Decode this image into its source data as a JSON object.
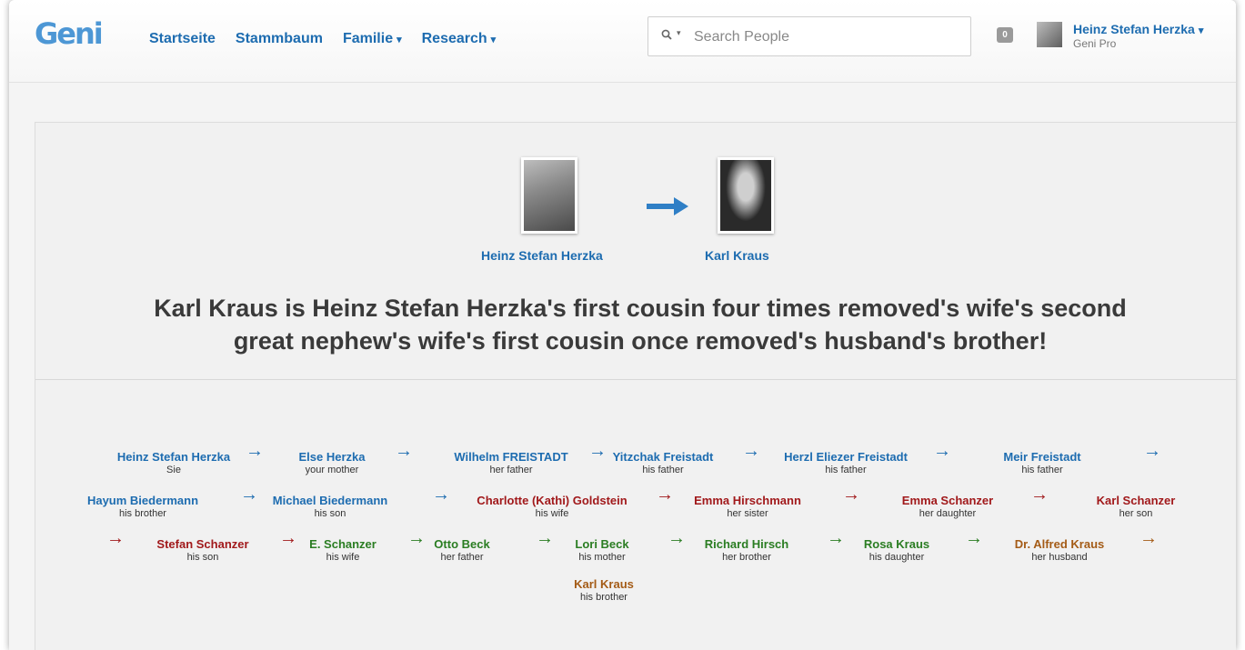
{
  "header": {
    "logo": "Geni",
    "nav": [
      {
        "label": "Startseite",
        "dropdown": false
      },
      {
        "label": "Stammbaum",
        "dropdown": false
      },
      {
        "label": "Familie",
        "dropdown": true
      },
      {
        "label": "Research",
        "dropdown": true
      }
    ],
    "search_placeholder": "Search People",
    "notification_count": "0",
    "user_name": "Heinz Stefan Herzka",
    "user_plan": "Geni Pro"
  },
  "relationship": {
    "from_name": "Heinz Stefan Herzka",
    "to_name": "Karl Kraus",
    "headline_1": "Karl Kraus is Heinz Stefan Herzka's first cousin four times removed's wife's second",
    "headline_2": "great nephew's wife's first cousin once removed's husband's brother!"
  },
  "colors": {
    "blue": "#1d6cb0",
    "red": "#a1191b",
    "green": "#2a7d22",
    "brown": "#a45b16"
  },
  "path": [
    {
      "name": "Heinz Stefan Herzka",
      "rel": "Sie",
      "color": "blue"
    },
    {
      "name": "Else Herzka",
      "rel": "your mother",
      "color": "blue"
    },
    {
      "name": "Wilhelm FREISTADT",
      "rel": "her father",
      "color": "blue"
    },
    {
      "name": "Yitzchak Freistadt",
      "rel": "his father",
      "color": "blue"
    },
    {
      "name": "Herzl Eliezer Freistadt",
      "rel": "his father",
      "color": "blue"
    },
    {
      "name": "Meir Freistadt",
      "rel": "his father",
      "color": "blue"
    },
    {
      "name": "Hayum Biedermann",
      "rel": "his brother",
      "color": "blue"
    },
    {
      "name": "Michael Biedermann",
      "rel": "his son",
      "color": "blue"
    },
    {
      "name": "Charlotte (Kathi) Goldstein",
      "rel": "his wife",
      "color": "red"
    },
    {
      "name": "Emma Hirschmann",
      "rel": "her sister",
      "color": "red"
    },
    {
      "name": "Emma Schanzer",
      "rel": "her daughter",
      "color": "red"
    },
    {
      "name": "Karl Schanzer",
      "rel": "her son",
      "color": "red"
    },
    {
      "name": "Stefan Schanzer",
      "rel": "his son",
      "color": "red"
    },
    {
      "name": "E. Schanzer",
      "rel": "his wife",
      "color": "green"
    },
    {
      "name": "Otto Beck",
      "rel": "her father",
      "color": "green"
    },
    {
      "name": "Lori Beck",
      "rel": "his mother",
      "color": "green"
    },
    {
      "name": "Richard Hirsch",
      "rel": "her brother",
      "color": "green"
    },
    {
      "name": "Rosa Kraus",
      "rel": "his daughter",
      "color": "green"
    },
    {
      "name": "Dr. Alfred Kraus",
      "rel": "her husband",
      "color": "brown"
    },
    {
      "name": "Karl Kraus",
      "rel": "his brother",
      "color": "brown"
    }
  ],
  "arrows": [
    "blue",
    "blue",
    "blue",
    "blue",
    "blue",
    "blue",
    "blue",
    "blue",
    "red",
    "red",
    "red",
    "red",
    "red",
    "green",
    "green",
    "green",
    "green",
    "green",
    "brown",
    "brown"
  ]
}
